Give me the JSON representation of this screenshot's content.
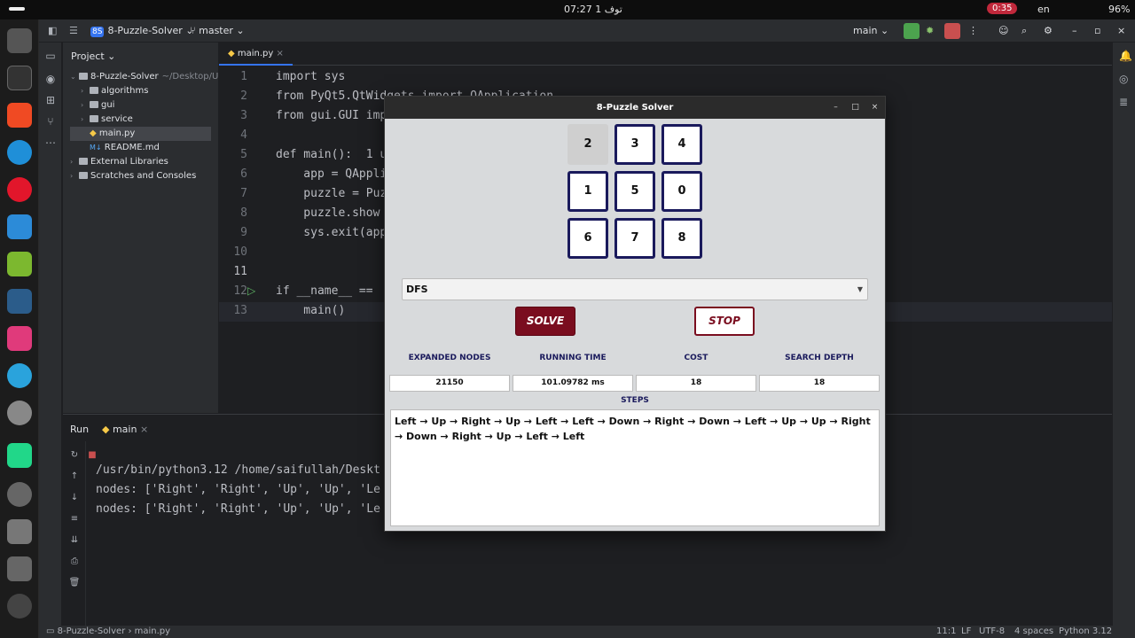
{
  "system": {
    "clock": "07:27 توف 1",
    "recording": "0:35",
    "language": "en",
    "battery": "96%"
  },
  "ide": {
    "project_name": "8-Puzzle-Solver",
    "project_badge": "8S",
    "branch": "master",
    "run_config": "main",
    "project_panel_title": "Project",
    "tree": [
      {
        "label": "8-Puzzle-Solver",
        "path": "~/Desktop/Uni",
        "indent": 0
      },
      {
        "label": "algorithms",
        "indent": 1
      },
      {
        "label": "gui",
        "indent": 1
      },
      {
        "label": "service",
        "indent": 1
      },
      {
        "label": "main.py",
        "indent": 1,
        "selected": true
      },
      {
        "label": "README.md",
        "indent": 1
      },
      {
        "label": "External Libraries",
        "indent": 0
      },
      {
        "label": "Scratches and Consoles",
        "indent": 0
      }
    ],
    "editor_tab": "main.py",
    "line_numbers": [
      "1",
      "2",
      "3",
      "4",
      "5",
      "6",
      "7",
      "8",
      "9",
      "10",
      "11",
      "12",
      "13"
    ],
    "code_lines": [
      "import sys",
      "from PyQt5.QtWidgets import QApplication",
      "from gui.GUI imp",
      "",
      "def main():  1 us",
      "    app = QAppli",
      "    puzzle = Puz",
      "    puzzle.show",
      "    sys.exit(app",
      "",
      "",
      "if __name__ == ",
      "    main()"
    ],
    "run_tab_label": "Run",
    "run_config_tab": "main",
    "console_lines": [
      "/usr/bin/python3.12 /home/saifullah/Deskt",
      "nodes: ['Right', 'Right', 'Up', 'Up', 'Le",
      "nodes: ['Right', 'Right', 'Up', 'Up', 'Le"
    ],
    "status": {
      "breadcrumb_project": "8-Puzzle-Solver",
      "breadcrumb_file": "main.py",
      "position": "11:1",
      "line_ending": "LF",
      "encoding": "UTF-8",
      "indent": "4 spaces",
      "interpreter": "Python 3.12"
    }
  },
  "dialog": {
    "title": "8-Puzzle Solver",
    "tiles": [
      "2",
      "3",
      "4",
      "1",
      "5",
      "0",
      "6",
      "7",
      "8"
    ],
    "algorithm": "DFS",
    "solve_label": "SOLVE",
    "stop_label": "STOP",
    "stats": [
      {
        "header": "EXPANDED NODES",
        "value": "21150"
      },
      {
        "header": "RUNNING TIME",
        "value": "101.09782 ms"
      },
      {
        "header": "COST",
        "value": "18"
      },
      {
        "header": "SEARCH DEPTH",
        "value": "18"
      }
    ],
    "steps_header": "STEPS",
    "steps_text": "Left → Up → Right → Up → Left → Left → Down → Right → Down → Left → Up → Up → Right → Down → Right → Up → Left → Left"
  }
}
